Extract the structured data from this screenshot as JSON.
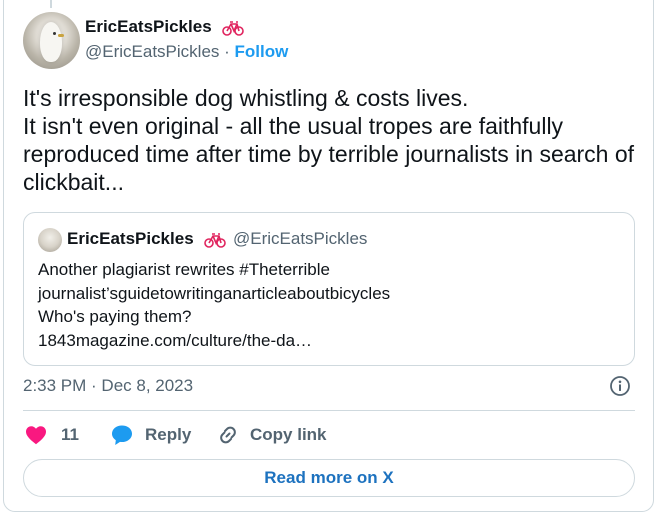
{
  "tweet": {
    "author_name": "EricEatsPickles",
    "handle": "@EricEatsPickles",
    "separator": " · ",
    "follow_label": "Follow",
    "text": "It's irresponsible dog whistling & costs lives.\nIt isn't even original - all the usual tropes are faithfully reproduced time after time by terrible journalists in search of clickbait...",
    "time": "2:33 PM",
    "date_separator": " · ",
    "date": "Dec 8, 2023"
  },
  "quote": {
    "author_name": "EricEatsPickles",
    "handle": "@EricEatsPickles",
    "lines": [
      "Another plagiarist rewrites #Theterrible",
      "journalist’sguidetowritinganarticleaboutbicycles",
      "Who's paying them?",
      "1843magazine.com/culture/the-da…"
    ]
  },
  "actions": {
    "like_count": "11",
    "reply_label": "Reply",
    "copy_link_label": "Copy link"
  },
  "read_more_label": "Read more on X",
  "icons": {
    "author_badge": "bicycle-icon",
    "like": "heart-icon",
    "reply": "speech-bubble-icon",
    "copy": "link-icon",
    "info": "info-icon"
  },
  "colors": {
    "accent": "#1d9bf0",
    "like": "#f91880",
    "reply": "#1d9bf0",
    "muted": "#536471",
    "border": "#cfd9de"
  }
}
